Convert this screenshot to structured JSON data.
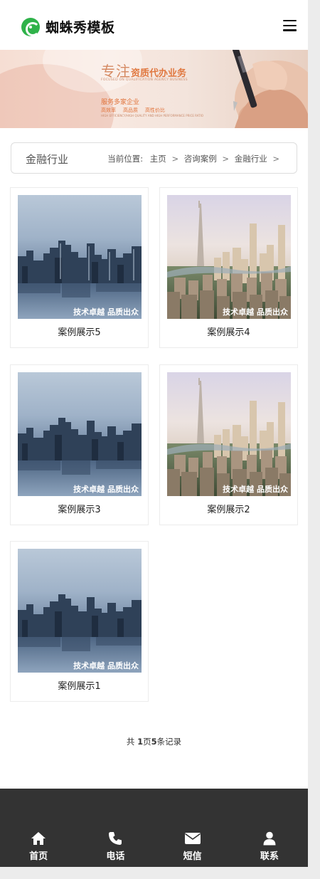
{
  "site": {
    "logo_text": "蜘蛛秀模板"
  },
  "banner": {
    "title_big": "专注",
    "title_rest": "资质代办业务",
    "subtitle": "FOCUSED ON QUALIFICATION AGENCY BUSINESS",
    "line2": "服务多家企业",
    "tags": [
      "高效率",
      "高品质",
      "高性价比"
    ],
    "subtitle2": "HIGH EFFICIENCY/HIGH QUALITY AND HIGH PERFORMANCE PRICE RATIO"
  },
  "breadcrumb": {
    "section_title": "金融行业",
    "prefix": "当前位置:",
    "items": [
      "主页",
      "咨询案例",
      "金融行业"
    ],
    "separator": ">"
  },
  "cases": [
    {
      "title": "案例展示5",
      "image_text": "技术卓越  品质出众"
    },
    {
      "title": "案例展示4",
      "image_text": "技术卓越  品质出众"
    },
    {
      "title": "案例展示3",
      "image_text": "技术卓越  品质出众"
    },
    {
      "title": "案例展示2",
      "image_text": "技术卓越  品质出众"
    },
    {
      "title": "案例展示1",
      "image_text": "技术卓越  品质出众"
    }
  ],
  "pagination": {
    "prefix": "共 ",
    "pages": "1",
    "mid": "页",
    "records": "5",
    "suffix": "条记录"
  },
  "tabbar": [
    {
      "label": "首页",
      "icon": "home-icon"
    },
    {
      "label": "电话",
      "icon": "phone-icon"
    },
    {
      "label": "短信",
      "icon": "envelope-icon"
    },
    {
      "label": "联系",
      "icon": "user-icon"
    }
  ],
  "colors": {
    "logo_green": "#2fb24a",
    "footer_bg": "#333333",
    "banner_orange": "#e0723a"
  }
}
